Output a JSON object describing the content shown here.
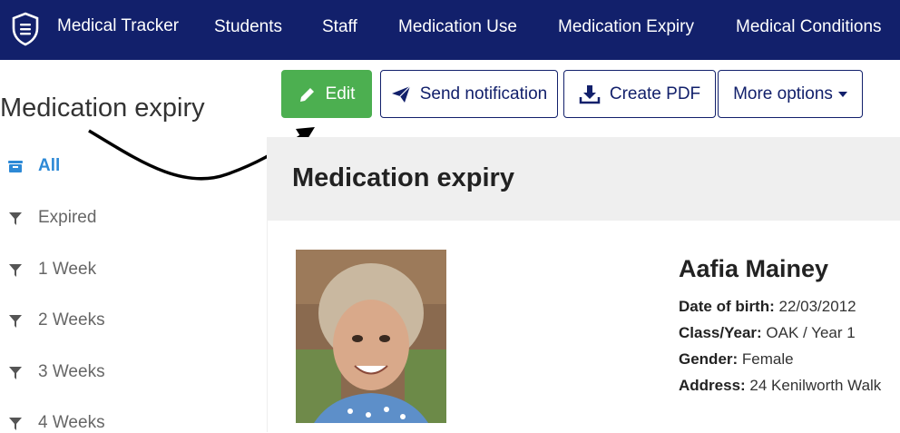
{
  "nav": {
    "brand": "Medical Tracker",
    "links": [
      "Students",
      "Staff",
      "Medication Use",
      "Medication Expiry",
      "Medical Conditions"
    ]
  },
  "page": {
    "heading": "Medication expiry"
  },
  "toolbar": {
    "edit_label": "Edit",
    "notify_label": "Send notification",
    "pdf_label": "Create PDF",
    "more_label": "More options"
  },
  "sidebar": {
    "items": [
      {
        "label": "All",
        "icon": "inbox-icon"
      },
      {
        "label": "Expired",
        "icon": "filter-icon"
      },
      {
        "label": "1 Week",
        "icon": "filter-icon"
      },
      {
        "label": "2 Weeks",
        "icon": "filter-icon"
      },
      {
        "label": "3 Weeks",
        "icon": "filter-icon"
      },
      {
        "label": "4 Weeks",
        "icon": "filter-icon"
      }
    ]
  },
  "panel": {
    "title": "Medication expiry",
    "student": {
      "name": "Aafia Mainey",
      "dob_label": "Date of birth:",
      "dob": "22/03/2012",
      "class_label": "Class/Year:",
      "class": "OAK / Year 1",
      "gender_label": "Gender:",
      "gender": "Female",
      "address_label": "Address:",
      "address": "24 Kenilworth Walk"
    }
  },
  "colors": {
    "nav_bg": "#12206b",
    "edit_bg": "#4caf50",
    "active": "#2d89d6"
  }
}
